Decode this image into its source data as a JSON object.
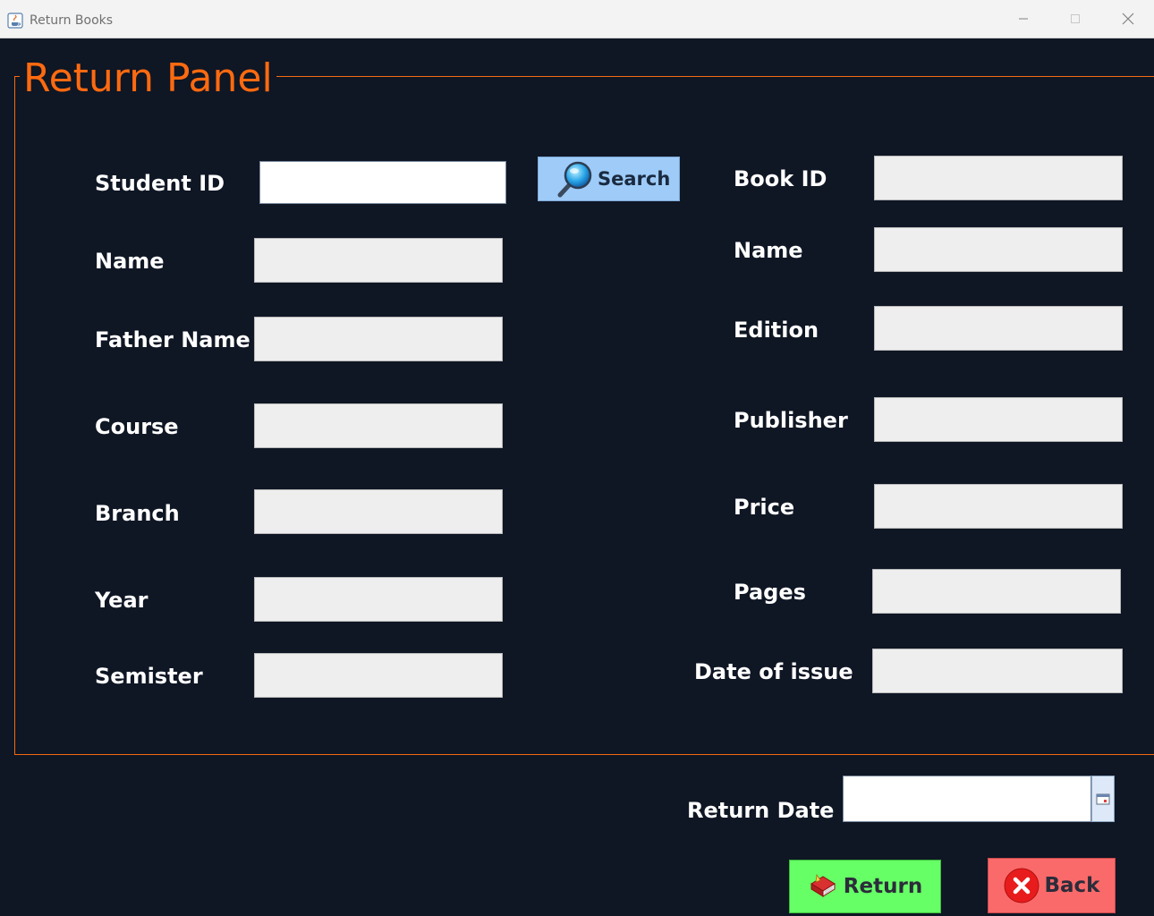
{
  "window": {
    "title": "Return Books",
    "icon": "java-cup-icon"
  },
  "panel": {
    "title": "Return Panel",
    "border_color": "#f56a12",
    "title_color": "#ff6a10",
    "background": "#0f1624"
  },
  "student": {
    "id_label": "Student ID",
    "id_value": "",
    "search_label": "Search",
    "fields": {
      "name": {
        "label": "Name",
        "value": ""
      },
      "father_name": {
        "label": "Father Name",
        "value": ""
      },
      "course": {
        "label": "Course",
        "value": ""
      },
      "branch": {
        "label": "Branch",
        "value": ""
      },
      "year": {
        "label": "Year",
        "value": ""
      },
      "semister": {
        "label": "Semister",
        "value": ""
      }
    }
  },
  "book": {
    "fields": {
      "book_id": {
        "label": "Book ID",
        "value": ""
      },
      "name": {
        "label": "Name",
        "value": ""
      },
      "edition": {
        "label": "Edition",
        "value": ""
      },
      "publisher": {
        "label": "Publisher",
        "value": ""
      },
      "price": {
        "label": "Price",
        "value": ""
      },
      "pages": {
        "label": "Pages",
        "value": ""
      },
      "date_of_issue": {
        "label": "Date of issue",
        "value": ""
      }
    }
  },
  "return_date": {
    "label": "Return Date",
    "value": ""
  },
  "actions": {
    "return_label": "Return",
    "back_label": "Back"
  },
  "colors": {
    "search_button": "#9ecbf8",
    "return_button": "#66ff66",
    "back_button": "#fa6a6a"
  }
}
